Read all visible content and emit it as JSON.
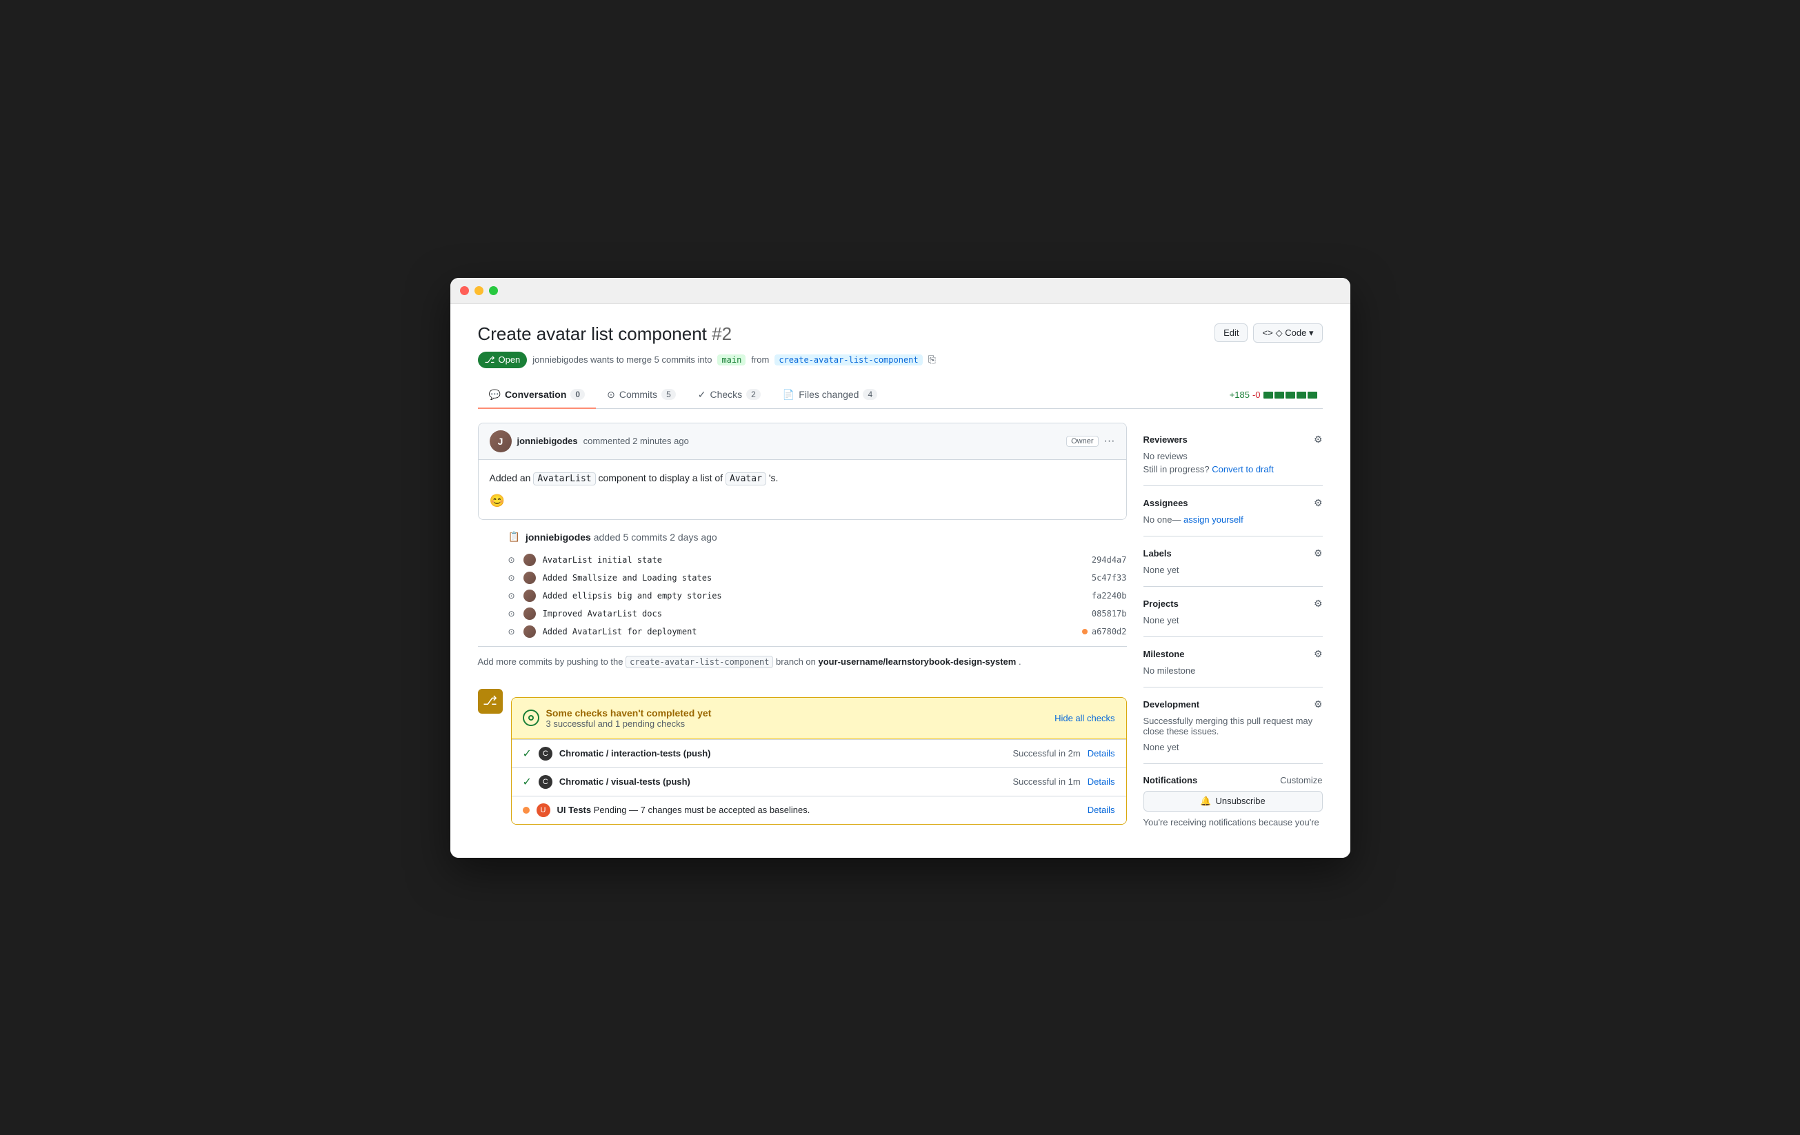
{
  "window": {
    "title": "Create avatar list component #2"
  },
  "pr": {
    "title": "Create avatar list component",
    "number": "#2",
    "status": "Open",
    "meta": "jonniebigodes wants to merge 5 commits into",
    "base_branch": "main",
    "from_text": "from",
    "head_branch": "create-avatar-list-component",
    "edit_label": "Edit",
    "code_label": "◇ Code ▾"
  },
  "tabs": [
    {
      "label": "Conversation",
      "icon": "💬",
      "count": "0",
      "active": true
    },
    {
      "label": "Commits",
      "icon": "⊙",
      "count": "5",
      "active": false
    },
    {
      "label": "Checks",
      "icon": "✓",
      "count": "2",
      "active": false
    },
    {
      "label": "Files changed",
      "icon": "📄",
      "count": "4",
      "active": false
    }
  ],
  "diff_stats": {
    "add": "+185",
    "del": "-0"
  },
  "comment": {
    "author": "jonniebigodes",
    "time": "commented 2 minutes ago",
    "badge": "Owner",
    "body_pre": "Added an",
    "code1": "AvatarList",
    "body_mid": "component to display a list of",
    "code2": "Avatar",
    "body_post": "'s."
  },
  "commits_section": {
    "actor": "jonniebigodes",
    "action": "added 5 commits",
    "time": "2 days ago",
    "commits": [
      {
        "msg": "AvatarList initial state",
        "sha": "294d4a7",
        "status": null
      },
      {
        "msg": "Added Smallsize and Loading states",
        "sha": "5c47f33",
        "status": null
      },
      {
        "msg": "Added ellipsis big and empty stories",
        "sha": "fa2240b",
        "status": null
      },
      {
        "msg": "Improved AvatarList docs",
        "sha": "085817b",
        "status": null
      },
      {
        "msg": "Added AvatarList for deployment",
        "sha": "a6780d2",
        "status": "pending"
      }
    ]
  },
  "add_commits": {
    "prefix": "Add more commits by pushing to the",
    "branch": "create-avatar-list-component",
    "middle": "branch on",
    "repo": "your-username/learnstorybook-design-system",
    "suffix": "."
  },
  "checks": {
    "icon_char": "⎇",
    "title": "Some checks haven't completed yet",
    "subtitle": "3 successful and 1 pending checks",
    "hide_label": "Hide all checks",
    "items": [
      {
        "type": "success",
        "name": "Chromatic / interaction-tests (push)",
        "status": "Successful in 2m",
        "details_label": "Details"
      },
      {
        "type": "success",
        "name": "Chromatic / visual-tests (push)",
        "status": "Successful in 1m",
        "details_label": "Details"
      },
      {
        "type": "pending",
        "name": "UI Tests",
        "status": "Pending — 7 changes must be accepted as baselines.",
        "details_label": "Details"
      }
    ]
  },
  "sidebar": {
    "reviewers": {
      "title": "Reviewers",
      "no_reviews": "No reviews",
      "in_progress": "Still in progress?",
      "convert": "Convert to draft"
    },
    "assignees": {
      "title": "Assignees",
      "no_one": "No one—",
      "assign": "assign yourself"
    },
    "labels": {
      "title": "Labels",
      "none_yet": "None yet"
    },
    "projects": {
      "title": "Projects",
      "none_yet": "None yet"
    },
    "milestone": {
      "title": "Milestone",
      "none": "No milestone"
    },
    "development": {
      "title": "Development",
      "description": "Successfully merging this pull request may close these issues.",
      "none_yet": "None yet"
    },
    "notifications": {
      "title": "Notifications",
      "customize": "Customize",
      "unsubscribe": "Unsubscribe",
      "receiving": "You're receiving notifications because you're"
    }
  }
}
